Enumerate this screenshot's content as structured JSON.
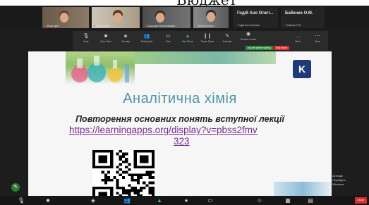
{
  "top_crop": {
    "text": "Бюджет"
  },
  "gallery": {
    "tiles": [
      {
        "name": "Юлия Кула"
      },
      {
        "name": "Юлия Денис"
      },
      {
        "name": "Самуськин Юлия Михайл..."
      },
      {
        "name": "Євгенія Віталії..."
      }
    ],
    "name_tiles": [
      {
        "big": "Годій Аня Олегі...",
        "small": "Годій Аня Олегівна"
      },
      {
        "big": "Бабенко О.М.",
        "small": "Бабенко О.М."
      }
    ]
  },
  "share_toolbar": {
    "items": [
      {
        "icon": "mic-icon",
        "label": "Mute"
      },
      {
        "icon": "video-icon",
        "label": "Stop Video"
      },
      {
        "icon": "security-icon",
        "label": "Security"
      },
      {
        "icon": "participants-icon",
        "label": "Participants"
      },
      {
        "icon": "chat-icon",
        "label": "Chat"
      },
      {
        "icon": "share-icon",
        "label": "New Share"
      },
      {
        "icon": "pause-icon",
        "label": "Pause Share"
      },
      {
        "icon": "annotate-icon",
        "label": "Annotate"
      },
      {
        "icon": "remote-control-icon",
        "label": "Remote Control"
      },
      {
        "icon": "more-icon",
        "label": "More"
      },
      {
        "icon": "more-icon",
        "label": "More"
      }
    ],
    "sharing_badge": "You are screen sharing",
    "stop_share": "Stop Share"
  },
  "slide": {
    "title": "Аналітична хімія",
    "subtitle": "Повторення основних понять вступної лекції",
    "link_line1": "https://learningapps.org/display?v=pbss2fmv",
    "link_line2": "323",
    "logo_letter": "K"
  },
  "right_overlay": {
    "lines": [
      "Активув",
      "Перейдіть",
      "Windows"
    ]
  },
  "bottom_bar": {
    "leave_label": "Leave"
  },
  "colors": {
    "title": "#4f93a8",
    "link": "#7a2c8f",
    "toolbar_bg": "#2b2b2b",
    "sharing_green": "#2d8c3c",
    "stop_red": "#d83030"
  }
}
